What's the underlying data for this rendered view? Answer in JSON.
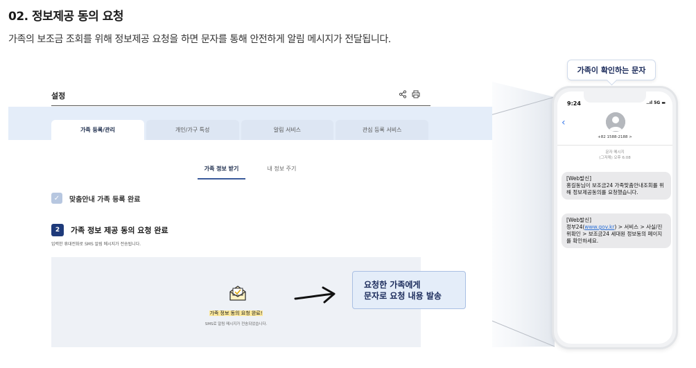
{
  "section": {
    "title": "02. 정보제공 동의 요청",
    "description": "가족의 보조금 조회를 위해 정보제공 요청을 하면 문자를 통해 안전하게 알림 메시지가 전달됩니다."
  },
  "screenshot": {
    "settings_title": "설정",
    "tabs": [
      {
        "label": "가족 등록/관리",
        "active": true
      },
      {
        "label": "개인/가구 특성",
        "active": false
      },
      {
        "label": "알림 서비스",
        "active": false
      },
      {
        "label": "관심 등록 서비스",
        "active": false
      }
    ],
    "subtabs": [
      {
        "label": "가족 정보 받기",
        "active": true
      },
      {
        "label": "내 정보 주기",
        "active": false
      }
    ],
    "step1": {
      "check": "✓",
      "label": "맞춤안내 가족 등록 완료"
    },
    "step2": {
      "number": "2",
      "label": "가족 정보 제공 동의 요청 완료",
      "desc": "입력한 휴대전화로 SMS 알림 메시지가 전송됩니다."
    },
    "complete": {
      "title": "가족 정보 동의 요청 완료!",
      "sub": "SMS로 알림 메시지가 전송되었습니다."
    }
  },
  "callout": {
    "line1": "요청한 가족에게",
    "line2": "문자로 요청 내용 발송"
  },
  "phone": {
    "label": "가족이 확인하는 문자",
    "time": "9:24",
    "status": "..ıl 5G ▬",
    "sender_number": "+82 1588-2188 >",
    "meta_line1": "문자 메시지",
    "meta_line2": "(그저께) 오후 6:08",
    "message1": {
      "tag": "[Web발신]",
      "body": "홍길동님이 보조금24 가족맞춤안내조회를 위해 정보제공동의를 요청했습니다."
    },
    "message2": {
      "tag": "[Web발신]",
      "prefix": "정부24(",
      "link": "www.gov.kr",
      "suffix": ") > 서비스 > 사실/진위확인 > 보조금24 세대원 정보동의 페이지를 확인하세요."
    }
  },
  "icons": {
    "share": "share-icon",
    "print": "print-icon",
    "envelope": "envelope-icon",
    "arrow": "arrow-right-icon",
    "back": "chevron-left-icon",
    "avatar": "person-icon"
  },
  "colors": {
    "primary": "#1e3a7a",
    "band": "#e4edf9",
    "highlight": "#fbe79a",
    "link": "#2a6fd6"
  }
}
